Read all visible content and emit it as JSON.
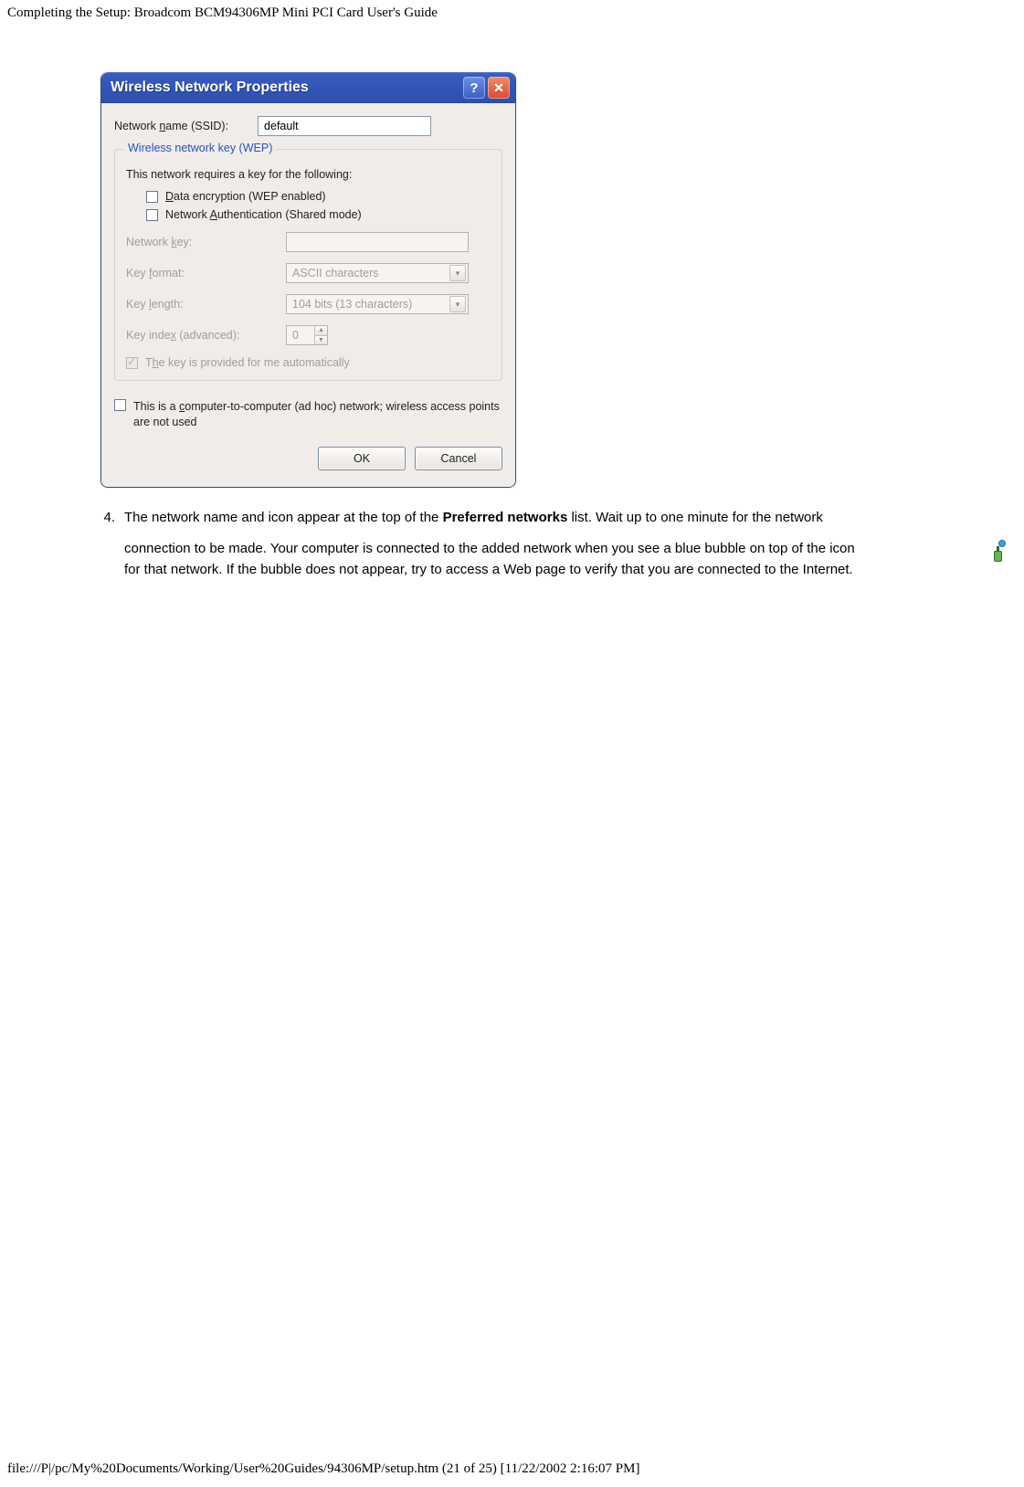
{
  "header": {
    "title": "Completing the Setup: Broadcom BCM94306MP Mini PCI Card User's Guide"
  },
  "dialog": {
    "title": "Wireless Network Properties",
    "ssid_label_pre": "Network ",
    "ssid_label_u": "n",
    "ssid_label_post": "ame (SSID):",
    "ssid_value": "default",
    "wep": {
      "legend": "Wireless network key (WEP)",
      "desc": "This network requires a key for the following:",
      "opt1_u": "D",
      "opt1_post": "ata encryption (WEP enabled)",
      "opt2_pre": "Network ",
      "opt2_u": "A",
      "opt2_post": "uthentication (Shared mode)",
      "key_label_pre": "Network ",
      "key_label_u": "k",
      "key_label_post": "ey:",
      "format_label_pre": "Key ",
      "format_label_u": "f",
      "format_label_post": "ormat:",
      "format_value": "ASCII characters",
      "length_label_pre": "Key ",
      "length_label_u": "l",
      "length_label_post": "ength:",
      "length_value": "104 bits (13 characters)",
      "index_label_pre": "Key inde",
      "index_label_u": "x",
      "index_label_post": " (advanced):",
      "index_value": "0",
      "auto_pre": "T",
      "auto_u": "h",
      "auto_post": "e key is provided for me automatically"
    },
    "adhoc_pre": "This is a ",
    "adhoc_u": "c",
    "adhoc_post": "omputer-to-computer (ad hoc) network; wireless access points are not used",
    "ok": "OK",
    "cancel": "Cancel"
  },
  "list": {
    "num": "4.",
    "p1_pre": "The network name and icon appear at the top of the ",
    "p1_bold": "Preferred networks",
    "p1_post": " list. Wait up to one minute for the network",
    "p2a": "connection to be made. Your computer is connected to the added network when you see a blue bubble on top of the icon",
    "p2b": "for that network. If the bubble does not appear, try to access a Web page to verify that you are connected to the Internet."
  },
  "footer": "file:///P|/pc/My%20Documents/Working/User%20Guides/94306MP/setup.htm (21 of 25) [11/22/2002 2:16:07 PM]"
}
